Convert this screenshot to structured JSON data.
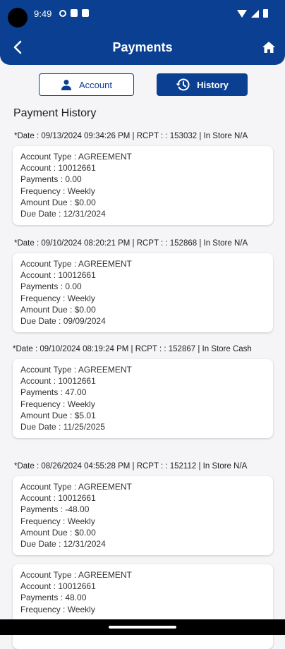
{
  "status_bar": {
    "time": "9:49"
  },
  "app_bar": {
    "title": "Payments"
  },
  "tabs": {
    "account_label": "Account",
    "history_label": "History"
  },
  "section_title": "Payment History",
  "labels": {
    "account_type": "Account Type : ",
    "account": "Account : ",
    "payments": "Payments : ",
    "frequency": "Frequency : ",
    "amount_due": "Amount Due : ",
    "due_date": "Due Date : "
  },
  "entries": [
    {
      "header": "*Date : 09/13/2024 09:34:26 PM | RCPT : : 153032 | In Store N/A",
      "account_type": "AGREEMENT",
      "account": "10012661",
      "payments": "0.00",
      "frequency": "Weekly",
      "amount_due": "$0.00",
      "due_date": "12/31/2024"
    },
    {
      "header": "*Date : 09/10/2024 08:20:21 PM | RCPT : : 152868 | In Store N/A",
      "account_type": "AGREEMENT",
      "account": "10012661",
      "payments": "0.00",
      "frequency": "Weekly",
      "amount_due": "$0.00",
      "due_date": "09/09/2024"
    },
    {
      "header": "*Date : 09/10/2024 08:19:24 PM | RCPT : : 152867 | In Store Cash",
      "account_type": "AGREEMENT",
      "account": "10012661",
      "payments": "47.00",
      "frequency": "Weekly",
      "amount_due": "$5.01",
      "due_date": "11/25/2025"
    },
    {
      "header": "*Date : 08/26/2024 04:55:28 PM | RCPT : : 152112 | In Store N/A",
      "account_type": "AGREEMENT",
      "account": "10012661",
      "payments": "-48.00",
      "frequency": "Weekly",
      "amount_due": "$0.00",
      "due_date": "12/31/2024"
    },
    {
      "header": "",
      "account_type": "AGREEMENT",
      "account": "10012661",
      "payments": "48.00",
      "frequency": "Weekly",
      "amount_due": "",
      "due_date": ""
    }
  ],
  "colors": {
    "primary": "#0b3f91",
    "background": "#f5f5f7",
    "card": "#ffffff"
  }
}
